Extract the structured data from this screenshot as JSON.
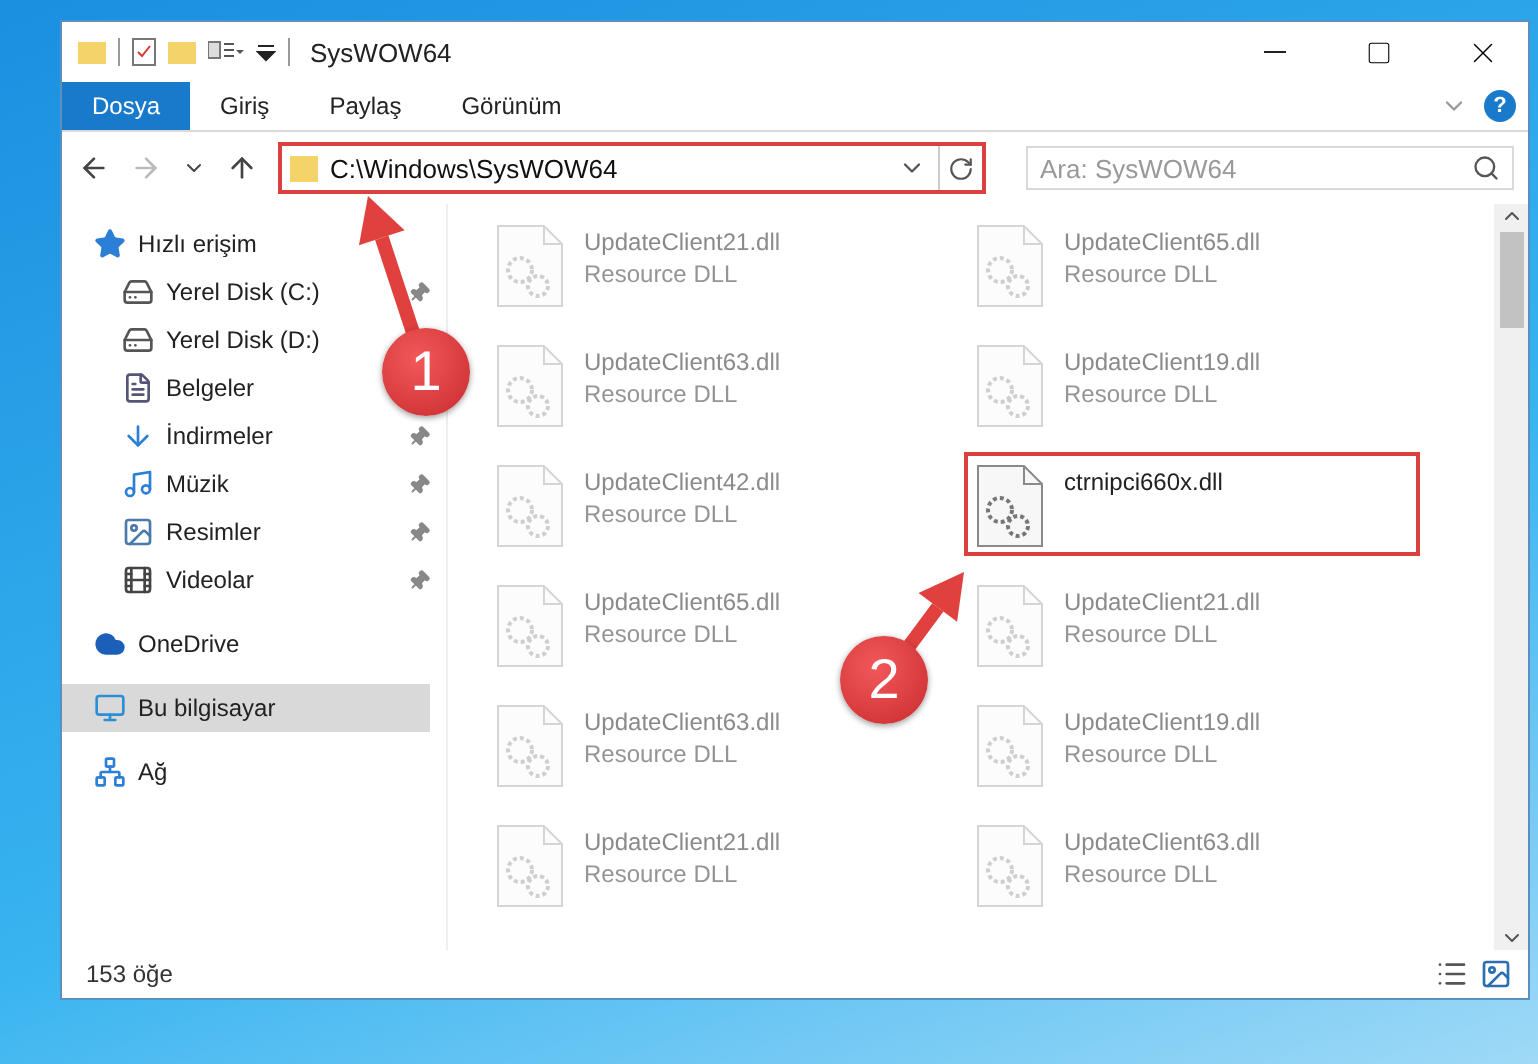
{
  "window": {
    "title": "SysWOW64"
  },
  "ribbon": {
    "tabs": [
      {
        "label": "Dosya",
        "selected": true
      },
      {
        "label": "Giriş",
        "selected": false
      },
      {
        "label": "Paylaş",
        "selected": false
      },
      {
        "label": "Görünüm",
        "selected": false
      }
    ],
    "help": "?"
  },
  "address": {
    "path": "C:\\Windows\\SysWOW64",
    "highlighted": true
  },
  "search": {
    "placeholder": "Ara: SysWOW64"
  },
  "sidebar": {
    "items": [
      {
        "label": "Hızlı erişim",
        "kind": "star",
        "selected": false,
        "children": [
          {
            "label": "Yerel Disk (C:)",
            "kind": "disk",
            "pinned": true,
            "selected": false
          },
          {
            "label": "Yerel Disk (D:)",
            "kind": "disk",
            "selected": false
          },
          {
            "label": "Belgeler",
            "kind": "docs",
            "selected": false
          },
          {
            "label": "İndirmeler",
            "kind": "download",
            "pinned": true,
            "selected": false
          },
          {
            "label": "Müzik",
            "kind": "music",
            "pinned": true,
            "selected": false
          },
          {
            "label": "Resimler",
            "kind": "pictures",
            "pinned": true,
            "selected": false
          },
          {
            "label": "Videolar",
            "kind": "video",
            "pinned": true,
            "selected": false
          }
        ]
      },
      {
        "label": "OneDrive",
        "kind": "cloud",
        "selected": false
      },
      {
        "label": "Bu bilgisayar",
        "kind": "pc",
        "selected": true
      },
      {
        "label": "Ağ",
        "kind": "network",
        "selected": false
      }
    ]
  },
  "files": [
    {
      "name": "UpdateClient21.dll",
      "type": "Resource DLL",
      "dimmed": true,
      "highlighted": false
    },
    {
      "name": "UpdateClient65.dll",
      "type": "Resource DLL",
      "dimmed": true,
      "highlighted": false
    },
    {
      "name": "UpdateClient63.dll",
      "type": "Resource DLL",
      "dimmed": true,
      "highlighted": false
    },
    {
      "name": "UpdateClient19.dll",
      "type": "Resource DLL",
      "dimmed": true,
      "highlighted": false
    },
    {
      "name": "UpdateClient42.dll",
      "type": "Resource DLL",
      "dimmed": true,
      "highlighted": false
    },
    {
      "name": "ctrnipci660x.dll",
      "dimmed": false,
      "highlighted": true
    },
    {
      "name": "UpdateClient65.dll",
      "type": "Resource DLL",
      "dimmed": true,
      "highlighted": false
    },
    {
      "name": "UpdateClient21.dll",
      "type": "Resource DLL",
      "dimmed": true,
      "highlighted": false
    },
    {
      "name": "UpdateClient63.dll",
      "type": "Resource DLL",
      "dimmed": true,
      "highlighted": false
    },
    {
      "name": "UpdateClient19.dll",
      "type": "Resource DLL",
      "dimmed": true,
      "highlighted": false
    },
    {
      "name": "UpdateClient21.dll",
      "type": "Resource DLL",
      "dimmed": true,
      "highlighted": false
    },
    {
      "name": "UpdateClient63.dll",
      "type": "Resource DLL",
      "dimmed": true,
      "highlighted": false
    }
  ],
  "status_bar": {
    "count": "153 öğe"
  },
  "annotations": [
    {
      "label": "1"
    },
    {
      "label": "2"
    }
  ]
}
